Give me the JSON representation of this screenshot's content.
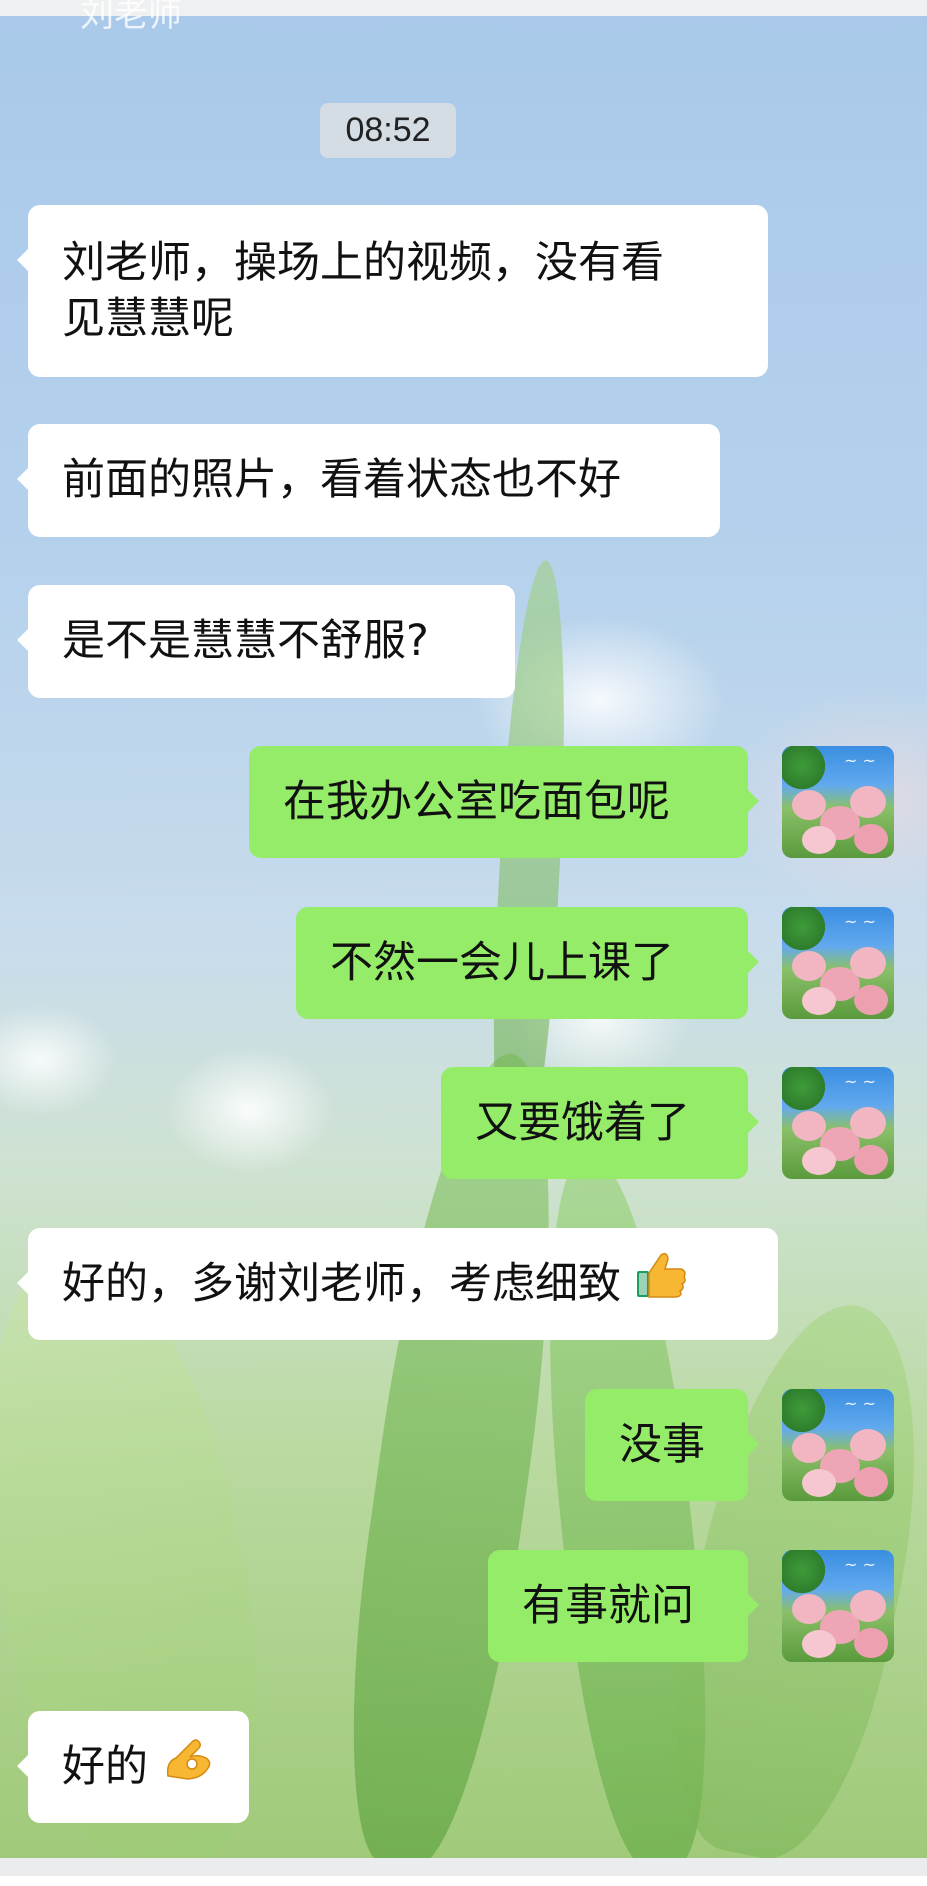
{
  "header": {
    "partial_title": "刘老师"
  },
  "timestamp": "08:52",
  "messages": [
    {
      "side": "in",
      "lines": [
        "刘老师，操场上的视频，没有看",
        "见慧慧呢"
      ]
    },
    {
      "side": "in",
      "text": "前面的照片，看着状态也不好"
    },
    {
      "side": "in",
      "text": "是不是慧慧不舒服?"
    },
    {
      "side": "out",
      "text": "在我办公室吃面包呢"
    },
    {
      "side": "out",
      "text": "不然一会儿上课了"
    },
    {
      "side": "out",
      "text": "又要饿着了"
    },
    {
      "side": "in",
      "text": "好的，多谢刘老师，考虑细致",
      "emoji": "thumbs-up"
    },
    {
      "side": "out",
      "text": "没事"
    },
    {
      "side": "out",
      "text": "有事就问"
    },
    {
      "side": "in",
      "text": "好的",
      "emoji": "ok-hand"
    }
  ],
  "avatar": {
    "icon": "flower-avatar-icon",
    "colors": {
      "sky": "#3a8ee0",
      "blossom": "#f2b6c2",
      "leaf": "#2e7d2c"
    }
  },
  "colors": {
    "incoming_bubble": "#ffffff",
    "outgoing_bubble": "#95ec69",
    "timestamp_bg": "#e1e1e1"
  }
}
